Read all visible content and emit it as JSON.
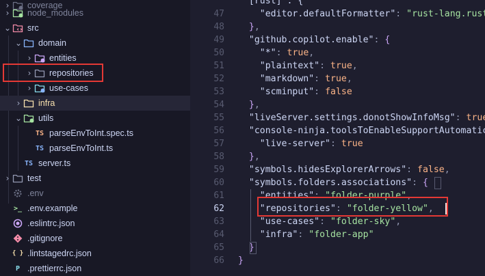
{
  "explorer": {
    "items": [
      {
        "label": "coverage",
        "icon": "coverage-folder-icon",
        "color": "#6c7086"
      },
      {
        "label": "node_modules",
        "icon": "node-modules-folder-icon",
        "color": "#a6e3a1"
      },
      {
        "label": "src",
        "icon": "src-folder-icon",
        "color": "#f38ba8"
      },
      {
        "label": "domain",
        "icon": "folder-icon",
        "color": "#89b4fa"
      },
      {
        "label": "entities",
        "icon": "folder-purple-icon",
        "color": "#cba6f7"
      },
      {
        "label": "repositories",
        "icon": "folder-icon",
        "color": "#9399b2"
      },
      {
        "label": "use-cases",
        "icon": "folder-sky-icon",
        "color": "#89dceb"
      },
      {
        "label": "infra",
        "icon": "folder-app-icon",
        "color": "#f9e2af"
      },
      {
        "label": "utils",
        "icon": "utils-folder-icon",
        "color": "#a6e3a1"
      },
      {
        "label": "parseEnvToInt.spec.ts",
        "icon": "ts-test-icon",
        "badge": "TS",
        "color": "#fab387"
      },
      {
        "label": "parseEnvToInt.ts",
        "icon": "typescript-icon",
        "badge": "TS",
        "color": "#89b4fa"
      },
      {
        "label": "server.ts",
        "icon": "typescript-icon",
        "badge": "TS",
        "color": "#89b4fa"
      },
      {
        "label": "test",
        "icon": "test-folder-icon",
        "color": "#9399b2"
      },
      {
        "label": ".env",
        "icon": "env-gear-icon",
        "color": "#6c7086"
      },
      {
        "label": ".env.example",
        "icon": "terminal-icon",
        "badge": ">_",
        "color": "#a6e3a1"
      },
      {
        "label": ".eslintrc.json",
        "icon": "eslint-icon",
        "color": "#cba6f7"
      },
      {
        "label": ".gitignore",
        "icon": "git-icon",
        "color": "#f38ba8"
      },
      {
        "label": ".lintstagedrc.json",
        "icon": "json-braces-icon",
        "badge": "{ }",
        "color": "#f9e2af"
      },
      {
        "label": ".prettierrc.json",
        "icon": "prettier-icon",
        "badge": "P",
        "color": "#89dceb"
      }
    ]
  },
  "editor": {
    "line_numbers": [
      "47",
      "48",
      "49",
      "50",
      "51",
      "52",
      "53",
      "54",
      "55",
      "56",
      "57",
      "58",
      "59",
      "60",
      "61",
      "62",
      "63",
      "64",
      "65",
      "66"
    ],
    "active_line": "62",
    "lines": [
      {
        "t": "    \"editor.defaultFormatter\": \"rust-lang.rust-analyzer\""
      },
      {
        "t": "  },"
      },
      {
        "t": "  \"github.copilot.enable\": {"
      },
      {
        "t": "    \"*\": true,"
      },
      {
        "t": "    \"plaintext\": true,"
      },
      {
        "t": "    \"markdown\": true,"
      },
      {
        "t": "    \"scminput\": false"
      },
      {
        "t": "  },"
      },
      {
        "t": "  \"liveServer.settings.donotShowInfoMsg\": true,"
      },
      {
        "t": "  \"console-ninja.toolsToEnableSupportAutomaticallyFor\": ["
      },
      {
        "t": "    \"live-server\": true"
      },
      {
        "t": "  },"
      },
      {
        "t": "  \"symbols.hidesExplorerArrows\": false,"
      },
      {
        "t": "  \"symbols.folders.associations\": {"
      },
      {
        "t": "    \"entities\": \"folder-purple\","
      },
      {
        "t": "    \"repositories\": \"folder-yellow\","
      },
      {
        "t": "    \"use-cases\": \"folder-sky\","
      },
      {
        "t": "    \"infra\": \"folder-app\""
      },
      {
        "t": "  }"
      },
      {
        "t": "}"
      }
    ],
    "top_partial": "  [rust]\": {"
  }
}
